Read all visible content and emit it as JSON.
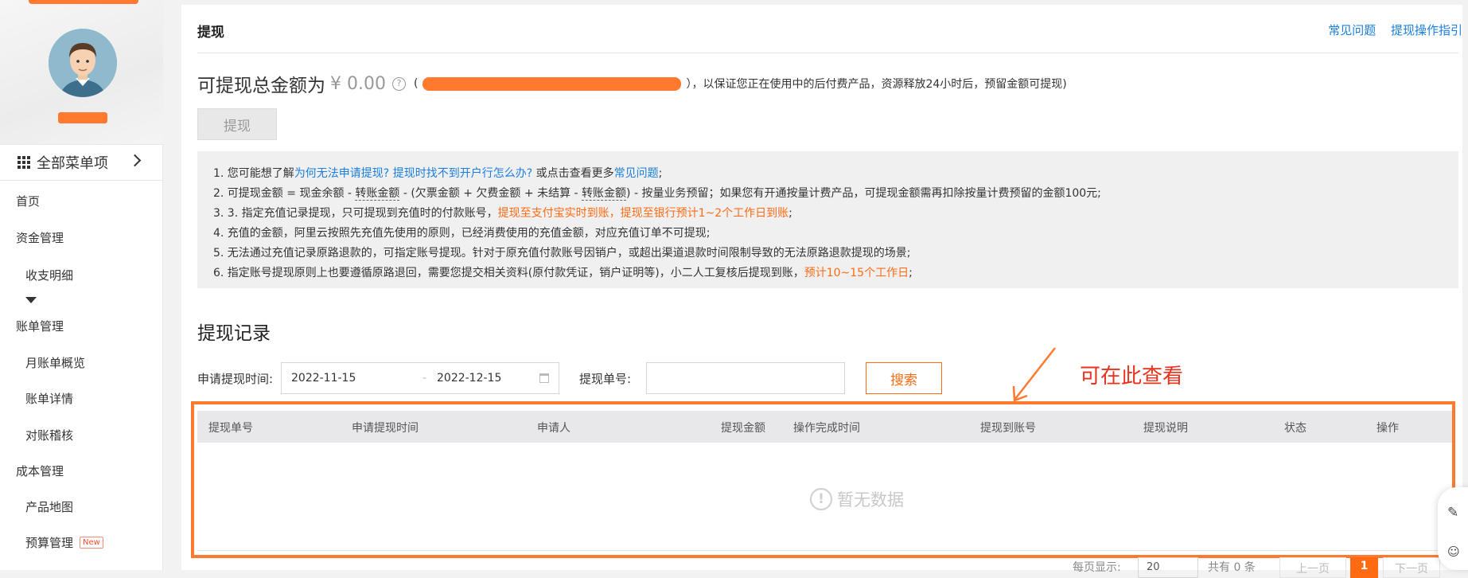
{
  "sidebar": {
    "all_menu": "全部菜单项",
    "items": [
      {
        "label": "首页",
        "level": 1
      },
      {
        "label": "资金管理",
        "level": 1
      },
      {
        "label": "收支明细",
        "level": 2
      },
      {
        "label": "账单管理",
        "level": 1
      },
      {
        "label": "月账单概览",
        "level": 2
      },
      {
        "label": "账单详情",
        "level": 2
      },
      {
        "label": "对账稽核",
        "level": 2
      },
      {
        "label": "成本管理",
        "level": 1
      },
      {
        "label": "产品地图",
        "level": 2
      },
      {
        "label": "预算管理",
        "level": 2,
        "badge": "New"
      }
    ]
  },
  "header": {
    "title": "提现",
    "links": [
      "常见问题",
      "提现操作指引"
    ]
  },
  "summary": {
    "label": "可提现总金额为",
    "amount": "¥ 0.00",
    "open_paren": "(",
    "note_tail": "），以保证您正在使用中的后付费产品，资源释放24小时后，预留金额可提现)",
    "button": "提现"
  },
  "notes": {
    "l1a": "1. 您可能想了解",
    "l1b": "为何无法申请提现?",
    "l1c": "提现时找不到开户行怎么办?",
    "l1d": "或点击查看更多",
    "l1e": "常见问题",
    "l1f": ";",
    "l2a": "2. 可提现金额 = 现金余额 - ",
    "l2b": "转账金额",
    "l2c": " - (欠票金额 + 欠费金额 + 未结算 - ",
    "l2d": "转账金额",
    "l2e": ") - 按量业务预留；如果您有开通按量计费产品，可提现金额需再扣除按量计费预留的金额100元;",
    "l3a": "3. 3. 指定充值记录提现，只可提现到充值时的付款账号，",
    "l3b": "提现至支付宝实时到账，提现至银行预计1~2个工作日到账",
    "l3c": ";",
    "l4": "4. 充值的金额，阿里云按照先充值先使用的原则，已经消费使用的充值金额，对应充值订单不可提现;",
    "l5": "5. 无法通过充值记录原路退款的，可指定账号提现。针对于原充值付款账号因销户，或超出渠道退款时间限制导致的无法原路退款提现的场景;",
    "l6a": "6. 指定账号提现原则上也要遵循原路退回，需要您提交相关资料(原付款凭证，销户证明等)，小二人工复核后提现到账，",
    "l6b": "预计10~15个工作日",
    "l6c": ";"
  },
  "records": {
    "title": "提现记录",
    "filter_time_label": "申请提现时间:",
    "date_start": "2022-11-15",
    "date_sep": "-",
    "date_end": "2022-12-15",
    "order_label": "提现单号:",
    "order_value": "",
    "search_button": "搜索",
    "columns": [
      "提现单号",
      "申请提现时间",
      "申请人",
      "提现金额",
      "操作完成时间",
      "提现到账号",
      "提现说明",
      "状态",
      "操作"
    ],
    "empty_text": "暂无数据"
  },
  "pager": {
    "per_page_label": "每页显示:",
    "per_page_value": "20",
    "total": "共有 0 条",
    "prev": "上一页",
    "current": "1",
    "next": "下一页"
  },
  "annotation": {
    "text": "可在此查看",
    "color": "#e8321e",
    "box_color": "#ff7a2f"
  },
  "colors": {
    "accent": "#ff6a13",
    "link": "#1a7fe0"
  }
}
